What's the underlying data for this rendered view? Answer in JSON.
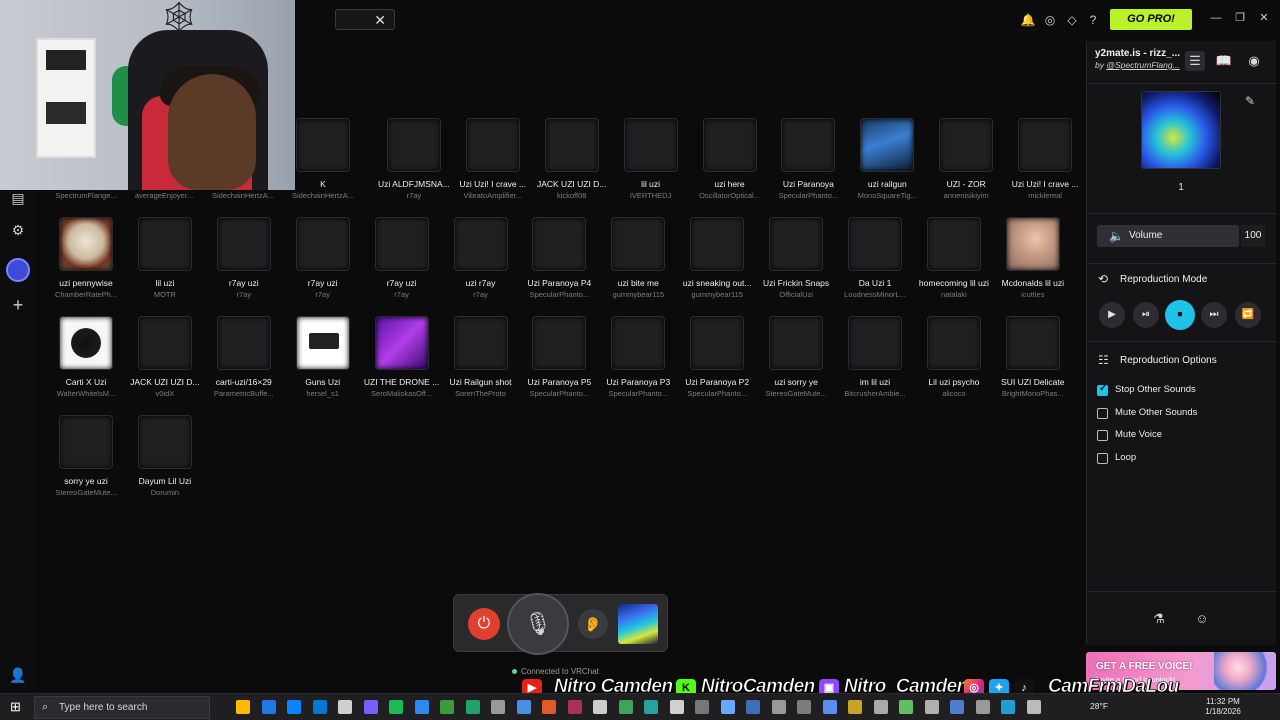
{
  "topbar": {
    "close_glyph": "✕",
    "go_pro": "GO PRO!"
  },
  "grid": {
    "rows": [
      [
        {
          "title": "K",
          "author": "SidechainHertzA...",
          "thumb": "none"
        },
        {
          "title": "Uzi ALDFJMSNA...",
          "author": "r7ay",
          "thumb": "none"
        },
        {
          "title": "Uzi Uzi! I crave ...",
          "author": "VibratoAmplifier...",
          "thumb": "none"
        },
        {
          "title": "JACK UZI UZI D...",
          "author": "kickoff08",
          "thumb": "none"
        },
        {
          "title": "lil uzi",
          "author": "IVERTHEDJ",
          "thumb": "none"
        },
        {
          "title": "uzi here",
          "author": "OscillatorOptical...",
          "thumb": "none"
        },
        {
          "title": "Uzi Paranoya",
          "author": "SpecularPhanto...",
          "thumb": "none"
        },
        {
          "title": "uzi railgun",
          "author": "MonoSquareTig...",
          "thumb": "railgun"
        },
        {
          "title": "UZI - ZOR",
          "author": "annenisikiyim",
          "thumb": "none"
        },
        {
          "title": "Uzi Uzi! I crave ...",
          "author": "micklereal",
          "thumb": "none"
        }
      ],
      [
        {
          "title": "uzi pennywise",
          "author": "ChamberRatePh...",
          "thumb": "penny"
        },
        {
          "title": "lil uzi",
          "author": "MOTR",
          "thumb": "none"
        },
        {
          "title": "r7ay uzi",
          "author": "r7ay",
          "thumb": "none"
        },
        {
          "title": "r7ay uzi",
          "author": "r7ay",
          "thumb": "none"
        },
        {
          "title": "r7ay uzi",
          "author": "r7ay",
          "thumb": "none"
        },
        {
          "title": "uzi r7ay",
          "author": "r7ay",
          "thumb": "none"
        },
        {
          "title": "Uzi Paranoya P4",
          "author": "SpecularPhanto...",
          "thumb": "none"
        },
        {
          "title": "uzi bite me",
          "author": "gummybear115",
          "thumb": "none"
        },
        {
          "title": "uzi sneaking out...",
          "author": "gummybear115",
          "thumb": "none"
        },
        {
          "title": "Uzi Frickin Snaps",
          "author": "OfficialUzi",
          "thumb": "none"
        },
        {
          "title": "Da Uzi 1",
          "author": "LoudnessMinorL...",
          "thumb": "none"
        },
        {
          "title": "homecoming lil uzi",
          "author": "natalaki",
          "thumb": "none"
        },
        {
          "title": "Mcdonalds lil uzi",
          "author": "icutties",
          "thumb": "mcd"
        }
      ],
      [
        {
          "title": "Carti X Uzi",
          "author": "WalterWhitelsM...",
          "thumb": "carti"
        },
        {
          "title": "JACK UZI UZI D...",
          "author": "v0idX",
          "thumb": "none"
        },
        {
          "title": "carti-uzi/16×29",
          "author": "ParametricBuffe...",
          "thumb": "none"
        },
        {
          "title": "Guns Uzi",
          "author": "hersel_s1",
          "thumb": "guns"
        },
        {
          "title": "UZI THE DRONE ...",
          "author": "SeroMaliskasOff...",
          "thumb": "drone"
        },
        {
          "title": "Uzi Railgun shot",
          "author": "SorenTheProto",
          "thumb": "none"
        },
        {
          "title": "Uzi Paranoya P5",
          "author": "SpecularPhanto...",
          "thumb": "none"
        },
        {
          "title": "Uzi Paranoya P3",
          "author": "SpecularPhanto...",
          "thumb": "none"
        },
        {
          "title": "Uzi Paranoya P2",
          "author": "SpecularPhanto...",
          "thumb": "none"
        },
        {
          "title": "uzi sorry ye",
          "author": "StereoGateMute...",
          "thumb": "none"
        },
        {
          "title": "im lil uzi",
          "author": "BitcrusherAmbie...",
          "thumb": "none"
        },
        {
          "title": "Lil uzi psycho",
          "author": "alicoco",
          "thumb": "none"
        },
        {
          "title": "SUI UZI Delicate",
          "author": "BrightMonoPhas...",
          "thumb": "none"
        }
      ],
      [
        {
          "title": "sorry ye uzi",
          "author": "StereoGateMute...",
          "thumb": "none"
        },
        {
          "title": "Dayum Lil Uzi",
          "author": "Dorumin",
          "thumb": "none"
        }
      ]
    ],
    "webcam_row_authors": [
      "SpectrumFlange...",
      "averageEnjoyer...",
      "SidechainHertzA..."
    ]
  },
  "player": {
    "status": "Connected to VRChat"
  },
  "panel": {
    "title": "y2mate.is - rizz_...",
    "by_prefix": "by ",
    "by_author": "@SpectrumFlang...",
    "count": "1",
    "volume_label": "Volume",
    "volume_value": "100",
    "volume_level": 1.0,
    "repro_mode_label": "Reproduction Mode",
    "repro_options_label": "Reproduction Options",
    "options": [
      {
        "label": "Stop Other Sounds",
        "checked": true
      },
      {
        "label": "Mute Other Sounds",
        "checked": false
      },
      {
        "label": "Mute Voice",
        "checked": false
      },
      {
        "label": "Loop",
        "checked": false
      }
    ]
  },
  "promo": {
    "title": "GET A FREE VOICE!",
    "sub": "Invite a friend to unlock!"
  },
  "socials": {
    "youtube": "Nitro Camden",
    "kick": "NitroCamden",
    "twitch": "Nitro_Camden",
    "tiktok": "CamFrmDaLou"
  },
  "taskbar": {
    "search_placeholder": "Type here to search",
    "weather": "28°F",
    "time": "11:32 PM",
    "date": "1/18/2026"
  },
  "colors": {
    "accent": "#1fc3e8",
    "go_pro": "#baf22a",
    "power": "#e0402f",
    "panel_bg": "#141416"
  }
}
